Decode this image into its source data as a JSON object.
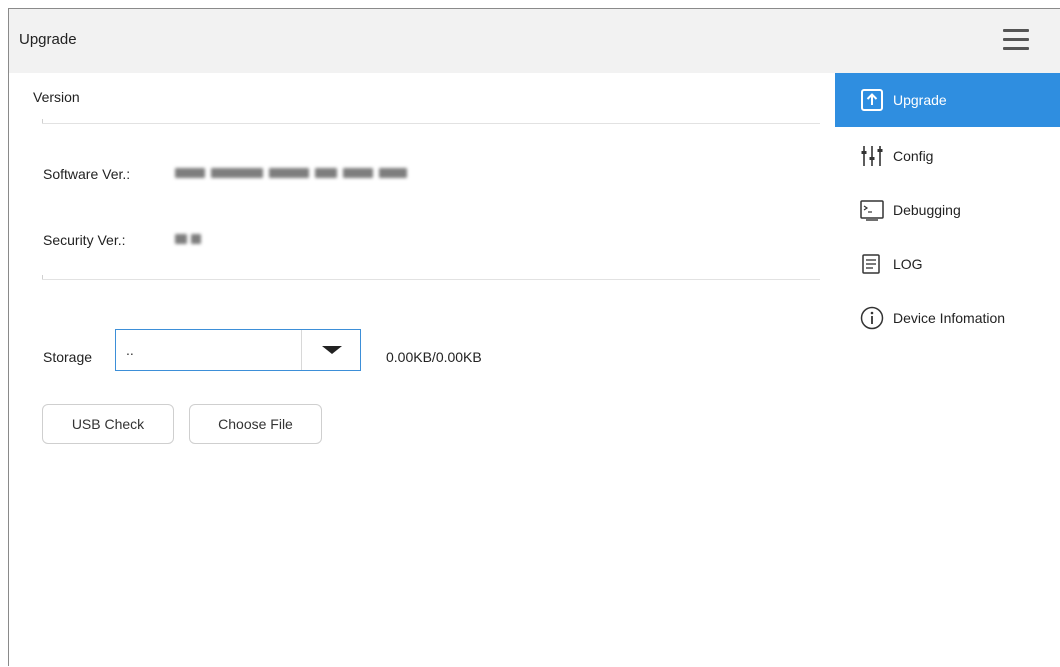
{
  "header": {
    "title": "Upgrade",
    "menu_icon": "hamburger-menu-icon"
  },
  "version": {
    "section_title": "Version",
    "software_label": "Software Ver.:",
    "security_label": "Security Ver.:"
  },
  "storage": {
    "label": "Storage",
    "selected": "..",
    "capacity": "0.00KB/0.00KB"
  },
  "actions": {
    "usb_check": "USB Check",
    "choose_file": "Choose File"
  },
  "sidebar": {
    "items": [
      {
        "label": "Upgrade",
        "icon": "upload-arrow-icon",
        "active": true
      },
      {
        "label": "Config",
        "icon": "sliders-icon",
        "active": false
      },
      {
        "label": "Debugging",
        "icon": "terminal-icon",
        "active": false
      },
      {
        "label": "LOG",
        "icon": "document-lines-icon",
        "active": false
      },
      {
        "label": "Device Infomation",
        "icon": "info-circle-icon",
        "active": false
      }
    ]
  },
  "colors": {
    "accent": "#2f8ee0",
    "header_bg": "#f2f2f2",
    "select_border": "#3d8fd8"
  }
}
